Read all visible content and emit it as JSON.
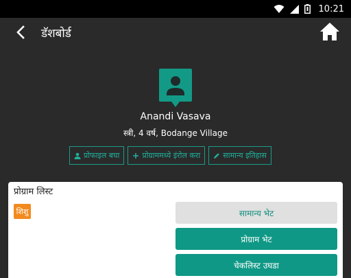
{
  "status_bar": {
    "time": "10:21",
    "icons": [
      "wifi-icon",
      "signal-icon",
      "battery-icon"
    ]
  },
  "app_bar": {
    "title": "डॅशबोर्ड",
    "back_icon": "back-arrow-icon",
    "home_icon": "home-icon"
  },
  "profile": {
    "name": "Anandi Vasava",
    "details": "स्त्री, 4 वर्ष, Bodange Village",
    "avatar_icon": "person-icon"
  },
  "actions": [
    {
      "label": "प्रोफाइल बघा",
      "icon": "person-icon"
    },
    {
      "label": "प्रोग्राममध्ये इंरोल करा",
      "icon": "plus-icon"
    },
    {
      "label": "सामान्य इतिहास",
      "icon": "pencil-icon"
    }
  ],
  "program_list": {
    "title": "प्रोग्राम लिस्ट",
    "badge": "शिशु",
    "buttons": {
      "general_visit": "सामान्य भेट",
      "program_visit": "प्रोग्राम भेट",
      "checklist": "चेकलिस्ट उघडा"
    }
  },
  "colors": {
    "accent": "#0f9886",
    "background": "#2a2a2a",
    "badge": "#f28a1e"
  }
}
